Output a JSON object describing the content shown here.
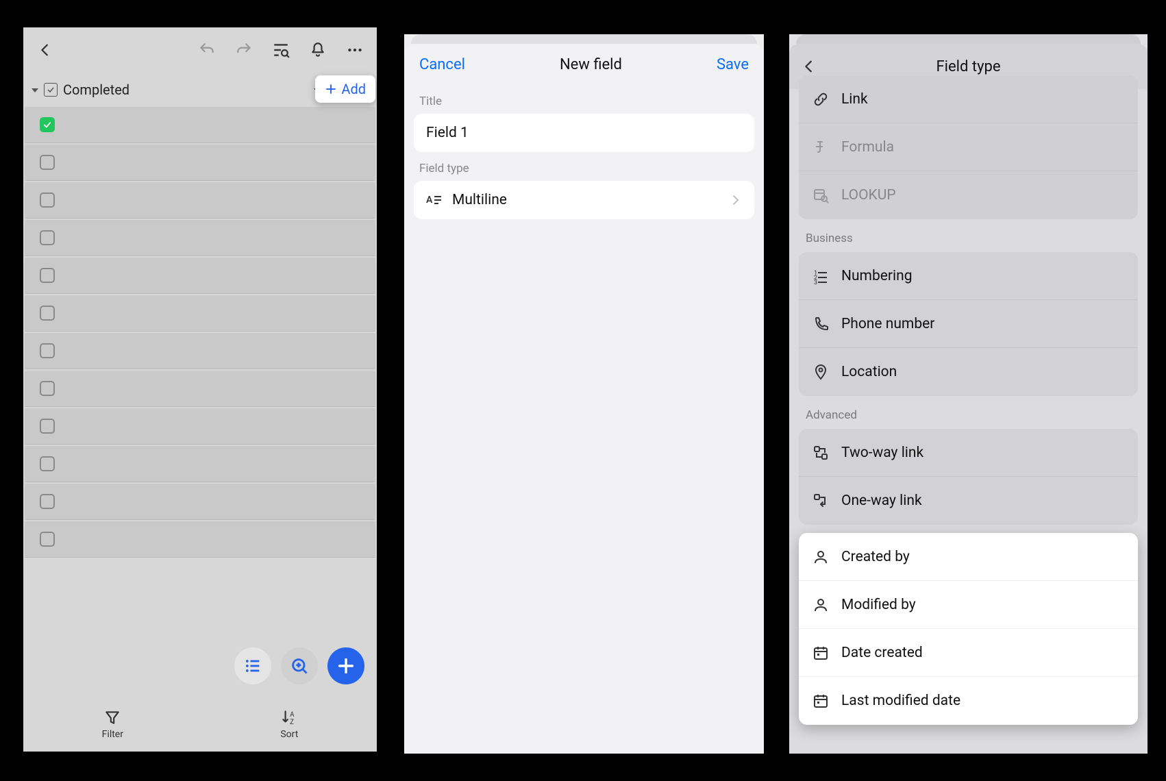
{
  "panel1": {
    "column_label": "Completed",
    "add_label": "Add",
    "rows_checked": [
      true,
      false,
      false,
      false,
      false,
      false,
      false,
      false,
      false,
      false,
      false,
      false
    ],
    "tab_filter": "Filter",
    "tab_sort": "Sort"
  },
  "panel2": {
    "cancel": "Cancel",
    "title": "New field",
    "save": "Save",
    "section_title": "Title",
    "field_value": "Field 1",
    "section_fieldtype": "Field type",
    "fieldtype_value": "Multiline"
  },
  "panel3": {
    "title": "Field type",
    "partial_items": [
      {
        "icon": "link",
        "label": "Link",
        "dim": false
      },
      {
        "icon": "formula",
        "label": "Formula",
        "dim": true
      },
      {
        "icon": "lookup",
        "label": "LOOKUP",
        "dim": true
      }
    ],
    "section_business": "Business",
    "business_items": [
      {
        "icon": "numbering",
        "label": "Numbering"
      },
      {
        "icon": "phone",
        "label": "Phone number"
      },
      {
        "icon": "location",
        "label": "Location"
      }
    ],
    "section_advanced": "Advanced",
    "advanced_items": [
      {
        "icon": "twoway",
        "label": "Two-way link"
      },
      {
        "icon": "oneway",
        "label": "One-way link"
      }
    ],
    "popup_items": [
      {
        "icon": "user",
        "label": "Created by"
      },
      {
        "icon": "user",
        "label": "Modified by"
      },
      {
        "icon": "calendar",
        "label": "Date created"
      },
      {
        "icon": "calendar",
        "label": "Last modified date"
      }
    ]
  }
}
